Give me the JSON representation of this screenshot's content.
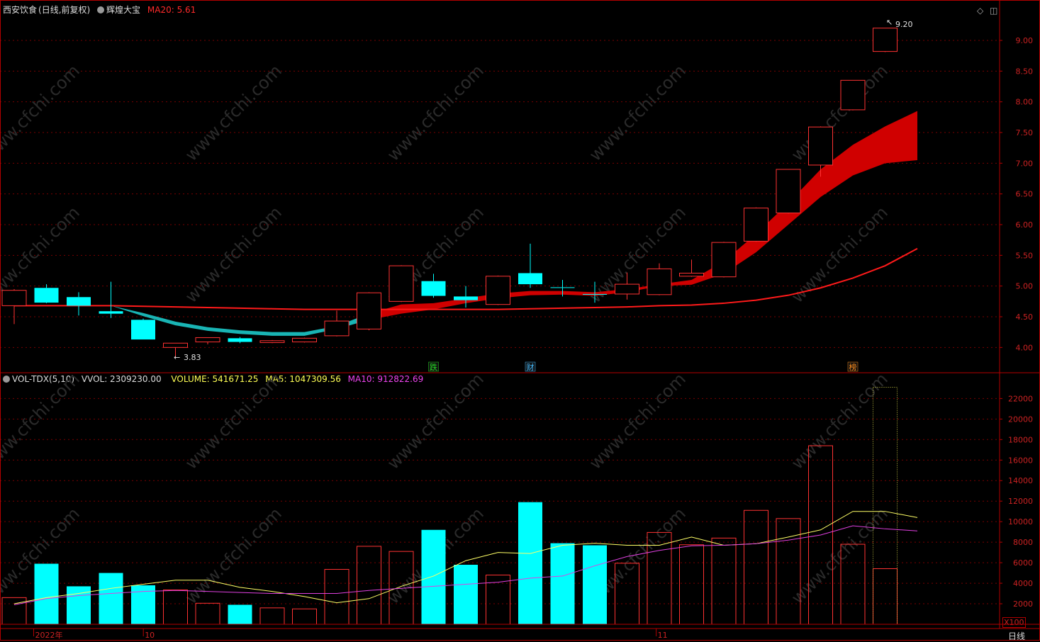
{
  "header": {
    "stock_name": "西安饮食",
    "period_label": "(日线,前复权)",
    "indicator_name": "辉煌大宝",
    "ma20_label": "MA20: 5.61"
  },
  "volume_header": {
    "name": "VOL-TDX(5,10)",
    "vvol": "VVOL: 2309230.00",
    "volume": "VOLUME: 541671.25",
    "ma5": "MA5: 1047309.56",
    "ma10": "MA10: 912822.69"
  },
  "annotations": {
    "low_label": "3.83",
    "high_label": "9.20",
    "badge_fall": "跌",
    "badge_money": "财",
    "badge_rank": "榜",
    "volume_unit": "X100",
    "period_tab": "日线"
  },
  "colors": {
    "up": "#ff3232",
    "down": "#00ffff",
    "axis": "#b40000",
    "grid": "#7a0000",
    "ma_red": "#ff1a1a",
    "ribbon_up": "#d00000",
    "ribbon_down": "#1cc8c8",
    "vol_ma5": "#ffff66",
    "vol_ma10": "#e040e0"
  },
  "chart_data": [
    {
      "type": "candlestick",
      "title": "西安饮食 (日线,前复权)",
      "price_axis": {
        "range": [
          3.6,
          9.45
        ],
        "ticks": [
          4.0,
          4.5,
          5.0,
          5.5,
          6.0,
          6.5,
          7.0,
          7.5,
          8.0,
          8.5,
          9.0
        ]
      },
      "candles": [
        {
          "o": 4.68,
          "h": 4.95,
          "l": 4.38,
          "c": 4.93
        },
        {
          "o": 4.97,
          "h": 5.03,
          "l": 4.72,
          "c": 4.73
        },
        {
          "o": 4.82,
          "h": 4.9,
          "l": 4.52,
          "c": 4.68
        },
        {
          "o": 4.59,
          "h": 5.07,
          "l": 4.48,
          "c": 4.55
        },
        {
          "o": 4.45,
          "h": 4.47,
          "l": 4.13,
          "c": 4.13
        },
        {
          "o": 4.0,
          "h": 4.06,
          "l": 3.83,
          "c": 4.07
        },
        {
          "o": 4.09,
          "h": 4.13,
          "l": 4.05,
          "c": 4.16
        },
        {
          "o": 4.15,
          "h": 4.17,
          "l": 4.07,
          "c": 4.09
        },
        {
          "o": 4.08,
          "h": 4.12,
          "l": 4.07,
          "c": 4.11
        },
        {
          "o": 4.09,
          "h": 4.16,
          "l": 4.08,
          "c": 4.15
        },
        {
          "o": 4.19,
          "h": 4.6,
          "l": 4.18,
          "c": 4.43
        },
        {
          "o": 4.3,
          "h": 4.9,
          "l": 4.28,
          "c": 4.89
        },
        {
          "o": 4.75,
          "h": 5.34,
          "l": 4.74,
          "c": 5.33
        },
        {
          "o": 5.08,
          "h": 5.2,
          "l": 4.81,
          "c": 4.84
        },
        {
          "o": 4.83,
          "h": 5.0,
          "l": 4.65,
          "c": 4.77
        },
        {
          "o": 4.7,
          "h": 5.17,
          "l": 4.69,
          "c": 5.16
        },
        {
          "o": 5.21,
          "h": 5.69,
          "l": 4.97,
          "c": 5.03
        },
        {
          "o": 4.98,
          "h": 5.1,
          "l": 4.83,
          "c": 4.97
        },
        {
          "o": 4.87,
          "h": 5.07,
          "l": 4.73,
          "c": 4.86
        },
        {
          "o": 4.87,
          "h": 5.22,
          "l": 4.78,
          "c": 5.03
        },
        {
          "o": 4.86,
          "h": 5.37,
          "l": 4.85,
          "c": 5.28
        },
        {
          "o": 5.16,
          "h": 5.43,
          "l": 5.15,
          "c": 5.21
        },
        {
          "o": 5.15,
          "h": 5.72,
          "l": 5.14,
          "c": 5.71
        },
        {
          "o": 5.73,
          "h": 6.28,
          "l": 5.72,
          "c": 6.27
        },
        {
          "o": 6.19,
          "h": 6.9,
          "l": 6.18,
          "c": 6.9
        },
        {
          "o": 6.97,
          "h": 7.6,
          "l": 6.78,
          "c": 7.59
        },
        {
          "o": 7.87,
          "h": 8.35,
          "l": 7.86,
          "c": 8.35
        },
        {
          "o": 8.82,
          "h": 9.2,
          "l": 8.81,
          "c": 9.2
        }
      ],
      "ma20": [
        4.68,
        4.68,
        4.68,
        4.68,
        4.67,
        4.66,
        4.65,
        4.64,
        4.63,
        4.62,
        4.62,
        4.62,
        4.62,
        4.62,
        4.62,
        4.62,
        4.63,
        4.64,
        4.65,
        4.66,
        4.68,
        4.69,
        4.72,
        4.77,
        4.85,
        4.97,
        5.13,
        5.33,
        5.61
      ],
      "ribbon_upper": [
        4.69,
        4.68,
        4.68,
        4.68,
        4.56,
        4.42,
        4.33,
        4.28,
        4.25,
        4.25,
        4.35,
        4.55,
        4.7,
        4.72,
        4.8,
        4.88,
        4.92,
        4.92,
        4.9,
        4.95,
        5.03,
        5.1,
        5.4,
        5.85,
        6.35,
        6.9,
        7.3,
        7.6,
        7.85
      ],
      "ribbon_lower": [
        4.69,
        4.68,
        4.68,
        4.68,
        4.51,
        4.36,
        4.27,
        4.22,
        4.19,
        4.19,
        4.3,
        4.45,
        4.55,
        4.62,
        4.72,
        4.8,
        4.85,
        4.86,
        4.84,
        4.9,
        5.0,
        5.02,
        5.2,
        5.55,
        6.0,
        6.45,
        6.8,
        7.0,
        7.05
      ],
      "ribbon_cross_index": 11
    },
    {
      "type": "bar",
      "title": "VOL-TDX(5,10)",
      "unit": "X100",
      "volume_axis": {
        "range": [
          0,
          23200
        ],
        "ticks": [
          2000,
          4000,
          6000,
          8000,
          10000,
          12000,
          14000,
          16000,
          18000,
          20000,
          22000
        ]
      },
      "volumes": [
        2600,
        5900,
        3700,
        5000,
        3800,
        3350,
        2050,
        1900,
        1600,
        1500,
        5350,
        7600,
        7100,
        9200,
        5800,
        4800,
        11900,
        7900,
        7700,
        5950,
        8950,
        7750,
        8400,
        11100,
        10300,
        17400,
        7800,
        5420
      ],
      "projected_volume_last": 23100,
      "ma5": [
        2000,
        2600,
        3000,
        3500,
        3900,
        4300,
        4300,
        3600,
        3200,
        2700,
        2100,
        2500,
        3700,
        4700,
        6200,
        7000,
        6900,
        7700,
        7900,
        7700,
        7700,
        8500,
        7700,
        7850,
        8500,
        9200,
        11000,
        11000,
        10400
      ],
      "ma10": [
        1900,
        2500,
        2800,
        3000,
        3200,
        3300,
        3200,
        3100,
        3000,
        3000,
        3000,
        3300,
        3500,
        3700,
        3900,
        4100,
        4500,
        4700,
        5700,
        6600,
        7200,
        7650,
        7700,
        7850,
        8200,
        8700,
        9600,
        9300,
        9100
      ]
    }
  ],
  "x_axis": [
    {
      "label": "2022年",
      "index": 1
    },
    {
      "label": "10",
      "index": 4.4
    },
    {
      "label": "11",
      "index": 20.3
    }
  ],
  "badges": [
    {
      "text_key": "badge_fall",
      "index": 13,
      "color": "#22dd22"
    },
    {
      "text_key": "badge_money",
      "index": 16,
      "color": "#44bbff"
    },
    {
      "text_key": "badge_rank",
      "index": 26,
      "color": "#ff8c1a"
    }
  ]
}
